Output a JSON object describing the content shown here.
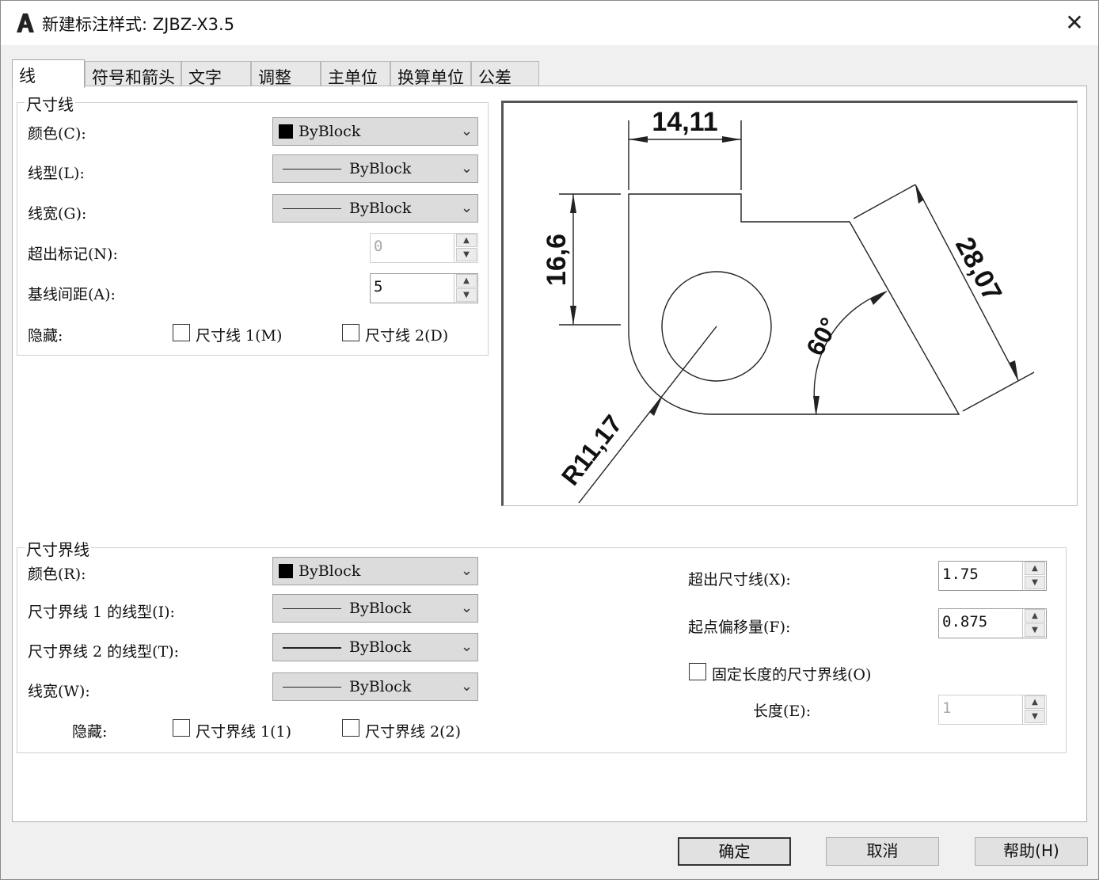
{
  "window": {
    "title": "新建标注样式: ZJBZ-X3.5",
    "close_glyph": "✕"
  },
  "tabs": [
    "线",
    "符号和箭头",
    "文字",
    "调整",
    "主单位",
    "换算单位",
    "公差"
  ],
  "dim_line": {
    "legend": "尺寸线",
    "color_label": "颜色(C):",
    "color_value": "ByBlock",
    "linetype_label": "线型(L):",
    "linetype_value": "ByBlock",
    "lineweight_label": "线宽(G):",
    "lineweight_value": "ByBlock",
    "extend_label": "超出标记(N):",
    "extend_value": "0",
    "baseline_label": "基线间距(A):",
    "baseline_value": "5",
    "suppress_label": "隐藏:",
    "suppress1": "尺寸线 1(M)",
    "suppress2": "尺寸线 2(D)"
  },
  "preview": {
    "dim_top": "14,11",
    "dim_left": "16,6",
    "dim_right": "28,07",
    "dim_angle": "60°",
    "dim_radius": "R11,17"
  },
  "ext_line": {
    "legend": "尺寸界线",
    "color_label": "颜色(R):",
    "color_value": "ByBlock",
    "lt1_label": "尺寸界线 1 的线型(I):",
    "lt1_value": "ByBlock",
    "lt2_label": "尺寸界线 2 的线型(T):",
    "lt2_value": "ByBlock",
    "lw_label": "线宽(W):",
    "lw_value": "ByBlock",
    "suppress_label": "隐藏:",
    "suppress1": "尺寸界线 1(1)",
    "suppress2": "尺寸界线 2(2)",
    "beyond_label": "超出尺寸线(X):",
    "beyond_value": "1.75",
    "offset_label": "起点偏移量(F):",
    "offset_value": "0.875",
    "fixed_label": "固定长度的尺寸界线(O)",
    "length_label": "长度(E):",
    "length_value": "1"
  },
  "buttons": {
    "ok": "确定",
    "cancel": "取消",
    "help": "帮助(H)"
  }
}
